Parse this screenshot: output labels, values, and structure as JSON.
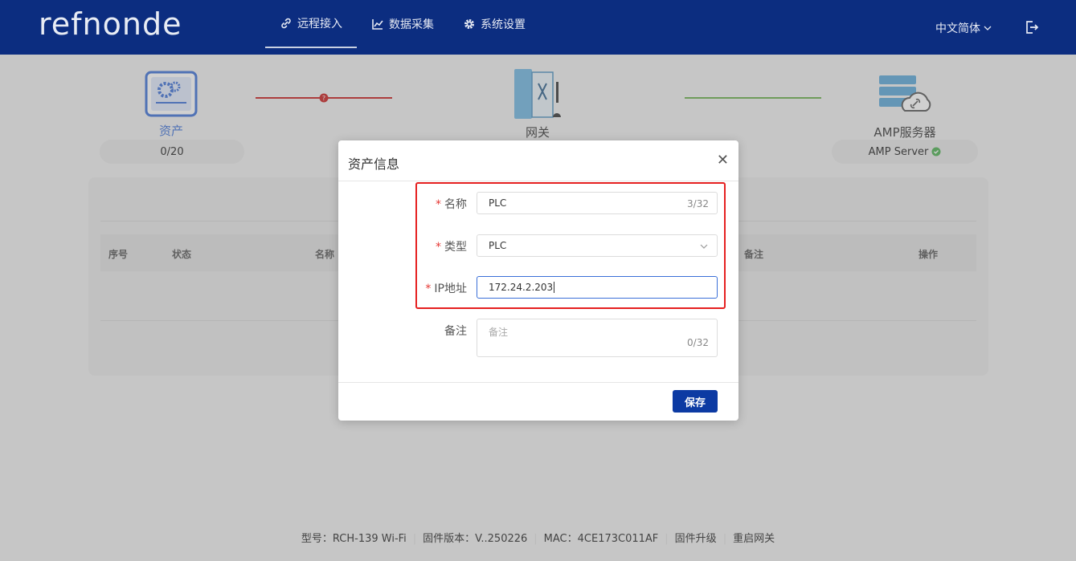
{
  "header": {
    "logo": "refnonde",
    "nav": [
      {
        "label": "远程接入",
        "icon": "link-icon",
        "active": true
      },
      {
        "label": "数据采集",
        "icon": "chart-icon",
        "active": false
      },
      {
        "label": "系统设置",
        "icon": "gear-icon",
        "active": false
      }
    ],
    "language": "中文简体"
  },
  "topology": {
    "asset": {
      "label": "资产",
      "count": "0/20"
    },
    "gateway": {
      "label": "网关"
    },
    "server": {
      "label": "AMP服务器",
      "status": "AMP Server"
    },
    "colors": {
      "asset_link": "#c81e1e",
      "server_link": "#6ab04c",
      "accent": "#3b6fd6"
    }
  },
  "table": {
    "columns": [
      "序号",
      "状态",
      "名称",
      "备注",
      "操作"
    ]
  },
  "modal": {
    "title": "资产信息",
    "fields": {
      "name": {
        "label": "名称",
        "value": "PLC",
        "count": "3/32"
      },
      "type": {
        "label": "类型",
        "value": "PLC"
      },
      "ip": {
        "label": "IP地址",
        "value": "172.24.2.203"
      },
      "remark": {
        "label": "备注",
        "placeholder": "备注",
        "count": "0/32"
      }
    },
    "required_mark": "*",
    "save_label": "保存"
  },
  "footer": {
    "items": [
      "型号：RCH-139  Wi-Fi",
      "固件版本：V..250226",
      "MAC：4CE173C011AF",
      "固件升级",
      "重启网关"
    ]
  }
}
